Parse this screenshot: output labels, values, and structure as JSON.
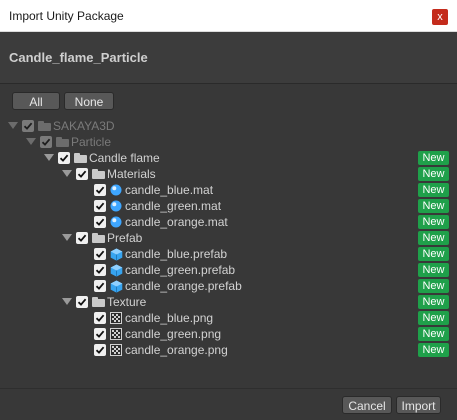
{
  "window": {
    "title": "Import Unity Package",
    "close_glyph": "x"
  },
  "header": {
    "package_name": "Candle_flame_Particle"
  },
  "selection": {
    "all_label": "All",
    "none_label": "None"
  },
  "tree": {
    "badge_label": "New",
    "rows": [
      {
        "label": "SAKAYA3D",
        "kind": "folder",
        "depth": 0,
        "checked": true,
        "dim": true,
        "badge": false
      },
      {
        "label": "Particle",
        "kind": "folder",
        "depth": 1,
        "checked": true,
        "dim": true,
        "badge": false
      },
      {
        "label": "Candle flame",
        "kind": "folder",
        "depth": 2,
        "checked": true,
        "dim": false,
        "badge": true
      },
      {
        "label": "Materials",
        "kind": "folder",
        "depth": 3,
        "checked": true,
        "dim": false,
        "badge": true
      },
      {
        "label": "candle_blue.mat",
        "kind": "material",
        "depth": 4,
        "checked": true,
        "dim": false,
        "badge": true
      },
      {
        "label": "candle_green.mat",
        "kind": "material",
        "depth": 4,
        "checked": true,
        "dim": false,
        "badge": true
      },
      {
        "label": "candle_orange.mat",
        "kind": "material",
        "depth": 4,
        "checked": true,
        "dim": false,
        "badge": true
      },
      {
        "label": "Prefab",
        "kind": "folder",
        "depth": 3,
        "checked": true,
        "dim": false,
        "badge": true
      },
      {
        "label": "candle_blue.prefab",
        "kind": "prefab",
        "depth": 4,
        "checked": true,
        "dim": false,
        "badge": true
      },
      {
        "label": "candle_green.prefab",
        "kind": "prefab",
        "depth": 4,
        "checked": true,
        "dim": false,
        "badge": true
      },
      {
        "label": "candle_orange.prefab",
        "kind": "prefab",
        "depth": 4,
        "checked": true,
        "dim": false,
        "badge": true
      },
      {
        "label": "Texture",
        "kind": "folder",
        "depth": 3,
        "checked": true,
        "dim": false,
        "badge": true
      },
      {
        "label": "candle_blue.png",
        "kind": "texture",
        "depth": 4,
        "checked": true,
        "dim": false,
        "badge": true
      },
      {
        "label": "candle_green.png",
        "kind": "texture",
        "depth": 4,
        "checked": true,
        "dim": false,
        "badge": true
      },
      {
        "label": "candle_orange.png",
        "kind": "texture",
        "depth": 4,
        "checked": true,
        "dim": false,
        "badge": true
      }
    ]
  },
  "footer": {
    "cancel_label": "Cancel",
    "import_label": "Import"
  },
  "colors": {
    "background": "#383838",
    "badge_green": "#1fa04a",
    "close_red": "#c42b1c",
    "material_icon": "#3ea6ff",
    "prefab_icon": "#37a4f0"
  }
}
